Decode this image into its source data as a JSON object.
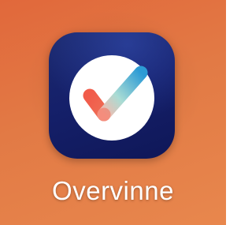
{
  "home_screen": {
    "background_color": "#e57a44",
    "app": {
      "name": "Overvinne",
      "icon": "checkmark-circle-icon",
      "tile_color": "#15206a",
      "check_colors": [
        "#f0604c",
        "#9fd6cf",
        "#2f9fd6"
      ]
    }
  }
}
